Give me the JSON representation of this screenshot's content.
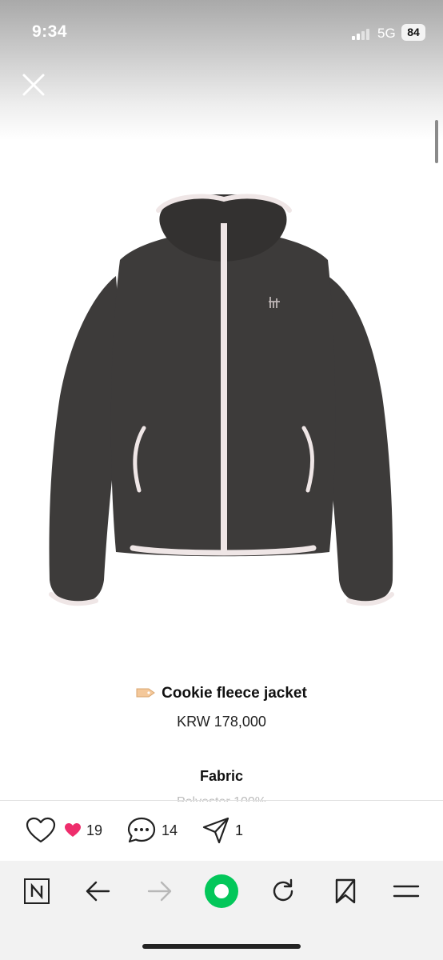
{
  "status_bar": {
    "time": "9:34",
    "network": "5G",
    "battery": "84"
  },
  "product": {
    "title": "Cookie fleece jacket",
    "price": "KRW 178,000",
    "fabric_heading": "Fabric",
    "fabric_value": "Polyester 100%",
    "jacket_color": "#3d3b3a",
    "trim_color": "#efe6e6"
  },
  "actions": {
    "likes_count": "19",
    "comments_count": "14",
    "shares_count": "1"
  },
  "browser_nav": {
    "icons": [
      "naver-icon",
      "back-arrow-icon",
      "forward-arrow-icon",
      "green-dot-icon",
      "refresh-icon",
      "bookmark-icon",
      "menu-icon"
    ],
    "accent_color": "#03c75a"
  }
}
